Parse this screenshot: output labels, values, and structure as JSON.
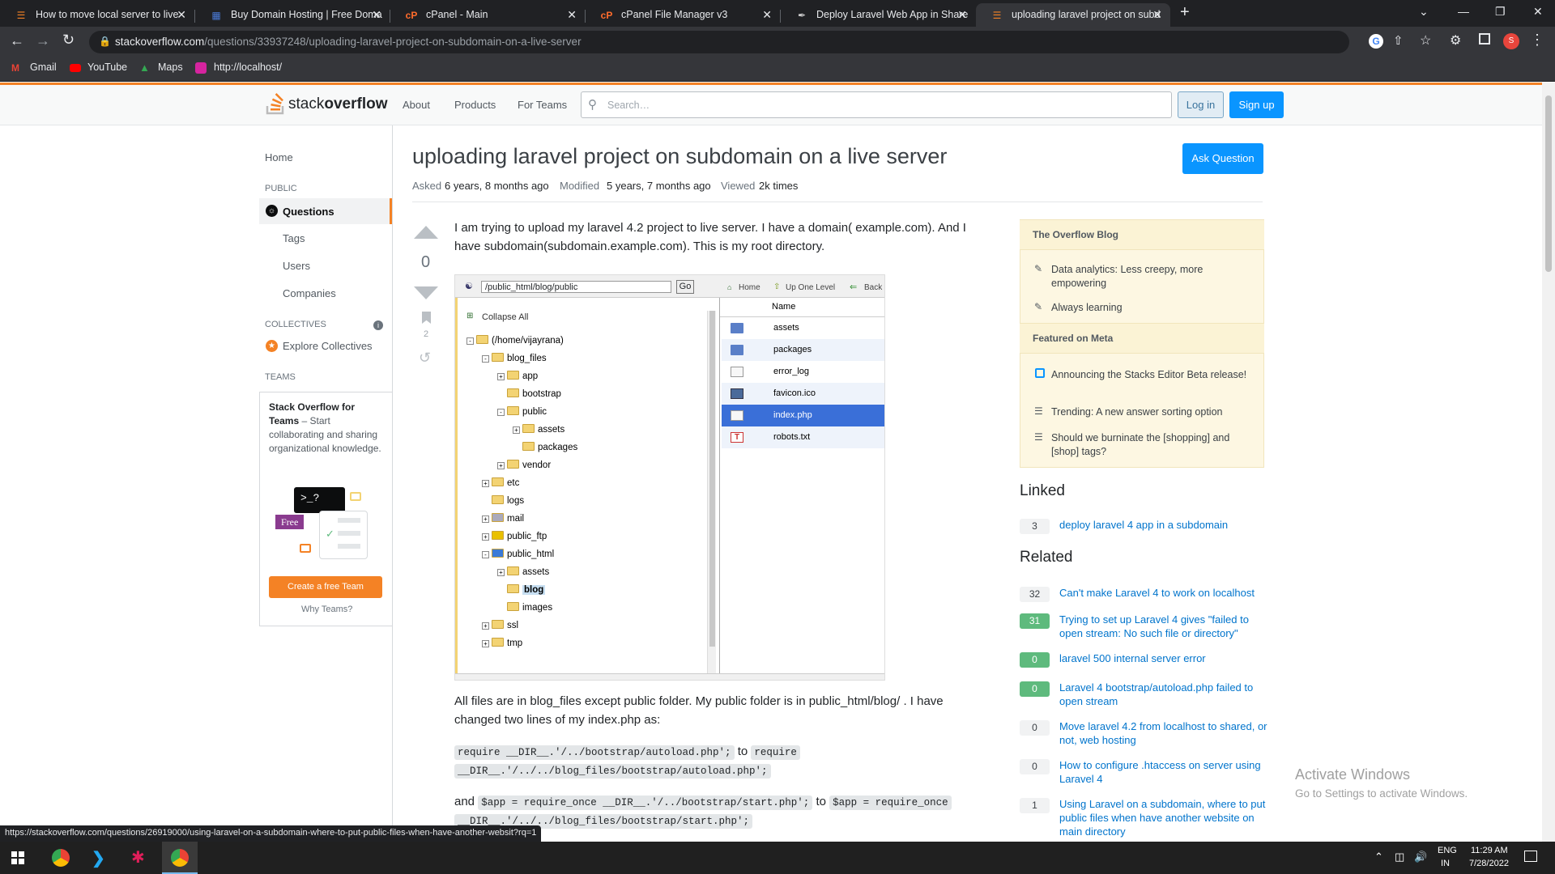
{
  "browser": {
    "tabs": [
      {
        "title": "How to move local server to live",
        "favicon": "stackoverflow-icon"
      },
      {
        "title": "Buy Domain Hosting | Free Doma",
        "favicon": "grid-icon"
      },
      {
        "title": "cPanel - Main",
        "favicon": "cpanel-icon"
      },
      {
        "title": "cPanel File Manager v3",
        "favicon": "cpanel-icon"
      },
      {
        "title": "Deploy Laravel Web App in Share",
        "favicon": "pen-icon"
      },
      {
        "title": "uploading laravel project on subd",
        "favicon": "stackoverflow-icon"
      }
    ],
    "new_tab": "+",
    "url_domain": "stackoverflow.com",
    "url_path": "/questions/33937248/uploading-laravel-project-on-subdomain-on-a-live-server",
    "profile_badge": "S",
    "bookmarks": [
      "Gmail",
      "YouTube",
      "Maps",
      "http://localhost/"
    ],
    "status_url": "https://stackoverflow.com/questions/26919000/using-laravel-on-a-subdomain-where-to-put-public-files-when-have-another-websit?rq=1"
  },
  "so_header": {
    "logo_text_a": "stack",
    "logo_text_b": "overflow",
    "nav": [
      "About",
      "Products",
      "For Teams"
    ],
    "search_placeholder": "Search…",
    "login": "Log in",
    "signup": "Sign up"
  },
  "left_nav": {
    "home": "Home",
    "public_label": "PUBLIC",
    "questions": "Questions",
    "tags": "Tags",
    "users": "Users",
    "companies": "Companies",
    "collectives_label": "COLLECTIVES",
    "explore_collectives": "Explore Collectives",
    "teams_label": "TEAMS",
    "teams_title": "Stack Overflow for Teams",
    "teams_desc": " – Start collaborating and sharing organizational knowledge.",
    "free_badge": "Free",
    "create_team": "Create a free Team",
    "why_teams": "Why Teams?"
  },
  "question": {
    "title": "uploading laravel project on subdomain on a live server",
    "ask_button": "Ask Question",
    "asked_label": "Asked",
    "asked_value": "6 years, 8 months ago",
    "modified_label": "Modified",
    "modified_value": "5 years, 7 months ago",
    "viewed_label": "Viewed",
    "viewed_value": "2k times",
    "votes": "0",
    "bookmarks": "2",
    "para1": "I am trying to upload my laravel 4.2 project to live server. I have a domain( example.com). And I have subdomain(subdomain.example.com). This is my root directory.",
    "para2": "All files are in blog_files except public folder. My public folder is in public_html/blog/ . I have changed two lines of my index.php as:",
    "code1": "require __DIR__.'/../bootstrap/autoload.php';",
    "to1": "to",
    "code2a": "require",
    "code2b": "__DIR__.'/../../blog_files/bootstrap/autoload.php';",
    "and": "and",
    "code3": "$app = require_once __DIR__.'/../bootstrap/start.php';",
    "to2": "to",
    "code4a": "$app = require_once",
    "code4b": "__DIR__.'/../../blog_files/bootstrap/start.php';"
  },
  "file_manager": {
    "path": "/public_html/blog/public",
    "go": "Go",
    "home": "Home",
    "up_one_level": "Up One Level",
    "back": "Back",
    "collapse_all": "Collapse All",
    "tree": [
      {
        "label": "(/home/vijayrana)",
        "indent": 0,
        "toggle": "-",
        "kind": "home"
      },
      {
        "label": "blog_files",
        "indent": 1,
        "toggle": "-",
        "kind": "folder"
      },
      {
        "label": "app",
        "indent": 2,
        "toggle": "+",
        "kind": "folder"
      },
      {
        "label": "bootstrap",
        "indent": 2,
        "toggle": "",
        "kind": "folder"
      },
      {
        "label": "public",
        "indent": 2,
        "toggle": "-",
        "kind": "folder"
      },
      {
        "label": "assets",
        "indent": 3,
        "toggle": "+",
        "kind": "folder"
      },
      {
        "label": "packages",
        "indent": 3,
        "toggle": "",
        "kind": "folder"
      },
      {
        "label": "vendor",
        "indent": 2,
        "toggle": "+",
        "kind": "folder"
      },
      {
        "label": "etc",
        "indent": 1,
        "toggle": "+",
        "kind": "folder"
      },
      {
        "label": "logs",
        "indent": 1,
        "toggle": "",
        "kind": "folder"
      },
      {
        "label": "mail",
        "indent": 1,
        "toggle": "+",
        "kind": "mail"
      },
      {
        "label": "public_ftp",
        "indent": 1,
        "toggle": "+",
        "kind": "ftp"
      },
      {
        "label": "public_html",
        "indent": 1,
        "toggle": "-",
        "kind": "globe"
      },
      {
        "label": "assets",
        "indent": 2,
        "toggle": "+",
        "kind": "folder"
      },
      {
        "label": "blog",
        "indent": 2,
        "toggle": "",
        "kind": "folder",
        "selected": true
      },
      {
        "label": "images",
        "indent": 2,
        "toggle": "",
        "kind": "folder"
      },
      {
        "label": "ssl",
        "indent": 1,
        "toggle": "+",
        "kind": "folder"
      },
      {
        "label": "tmp",
        "indent": 1,
        "toggle": "+",
        "kind": "folder"
      }
    ],
    "name_header": "Name",
    "files": [
      {
        "name": "assets",
        "kind": "folder"
      },
      {
        "name": "packages",
        "kind": "folder"
      },
      {
        "name": "error_log",
        "kind": "file"
      },
      {
        "name": "favicon.ico",
        "kind": "image"
      },
      {
        "name": "index.php",
        "kind": "php",
        "selected": true
      },
      {
        "name": "robots.txt",
        "kind": "text"
      }
    ]
  },
  "sidebar": {
    "blog_title": "The Overflow Blog",
    "blog_items": [
      "Data analytics: Less creepy, more empowering",
      "Always learning"
    ],
    "meta_title": "Featured on Meta",
    "meta_items": [
      "Announcing the Stacks Editor Beta release!",
      "Trending: A new answer sorting option",
      "Should we burninate the [shopping] and [shop] tags?"
    ],
    "linked_title": "Linked",
    "linked": [
      {
        "count": "3",
        "title": "deploy laravel 4 app in a subdomain",
        "accepted": false
      }
    ],
    "related_title": "Related",
    "related": [
      {
        "count": "32",
        "title": "Can't make Laravel 4 to work on localhost",
        "accepted": false
      },
      {
        "count": "31",
        "title": "Trying to set up Laravel 4 gives \"failed to open stream: No such file or directory\"",
        "accepted": true
      },
      {
        "count": "0",
        "title": "laravel 500 internal server error",
        "accepted": true
      },
      {
        "count": "0",
        "title": "Laravel 4 bootstrap/autoload.php failed to open stream",
        "accepted": true
      },
      {
        "count": "0",
        "title": "Move laravel 4.2 from localhost to shared, or not, web hosting",
        "accepted": false
      },
      {
        "count": "0",
        "title": "How to configure .htaccess on server using Laravel 4",
        "accepted": false
      },
      {
        "count": "1",
        "title": "Using Laravel on a subdomain, where to put public files when have another website on main directory",
        "accepted": false
      }
    ]
  },
  "watermark": {
    "title": "Activate Windows",
    "subtitle": "Go to Settings to activate Windows."
  },
  "taskbar": {
    "lang": "ENG",
    "region": "IN",
    "time": "11:29 AM",
    "date": "7/28/2022"
  },
  "colors": {
    "so_orange": "#f48225",
    "so_blue": "#0a95ff",
    "link": "#0074cc",
    "accepted_green": "#5eba7d"
  }
}
